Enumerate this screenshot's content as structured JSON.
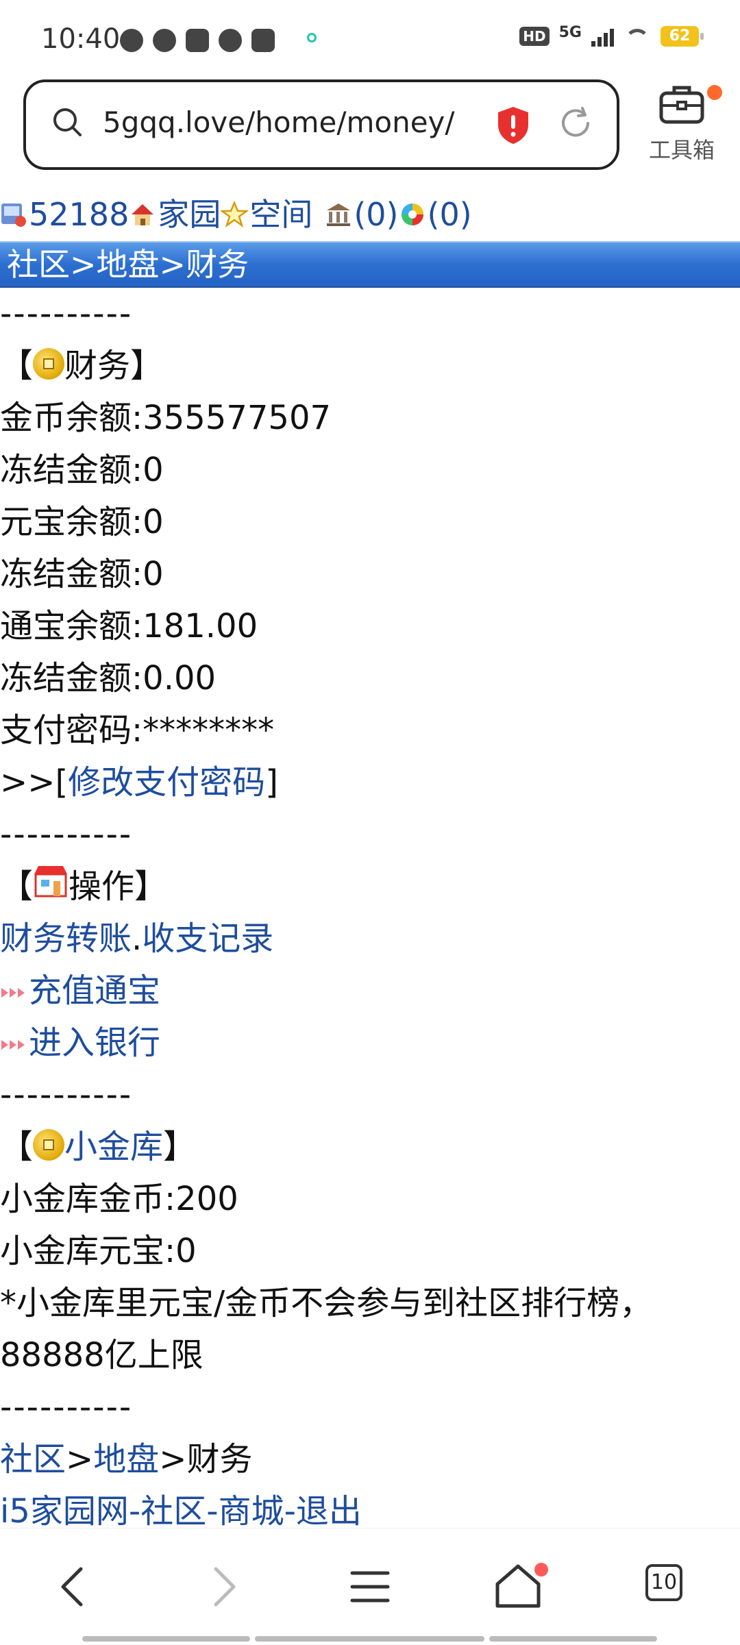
{
  "status": {
    "time": "10:40",
    "hd": "HD",
    "network": "5G",
    "battery": "62"
  },
  "browser": {
    "url": "5gqq.love/home/money/",
    "toolbox_label": "工具箱",
    "tab_count": "10"
  },
  "topnav": {
    "user_id": "52188",
    "home": "家园",
    "space": "空间",
    "bank_count": "(0)",
    "msg_count": "(0)"
  },
  "breadcrumb_bar": "社区>地盘>财务",
  "dashes": "----------",
  "finance": {
    "open": "【",
    "title": "财务",
    "close": "】",
    "rows": [
      "金币余额:355577507",
      "冻结金额:0",
      "元宝余额:0",
      "冻结金额:0",
      "通宝余额:181.00",
      "冻结金额:0.00",
      "支付密码:********"
    ],
    "change_prefix": ">>[",
    "change_link": "修改支付密码",
    "change_suffix": "]"
  },
  "operations": {
    "title": "操作",
    "transfer": "财务转账",
    "dot": ".",
    "records": "收支记录",
    "recharge": "充值通宝",
    "bank": "进入银行"
  },
  "vault": {
    "title": "小金库",
    "coins": "小金库金币:200",
    "ingots": "小金库元宝:0",
    "note1": "*小金库里元宝/金币不会参与到社区排行榜，",
    "note2": "88888亿上限"
  },
  "footer": {
    "crumb_community": "社区",
    "gt": ">",
    "crumb_territory": "地盘",
    "crumb_current": "财务",
    "site": "i5家园网",
    "sep": "-",
    "community": "社区",
    "mall": "商城",
    "logout": "退出"
  }
}
